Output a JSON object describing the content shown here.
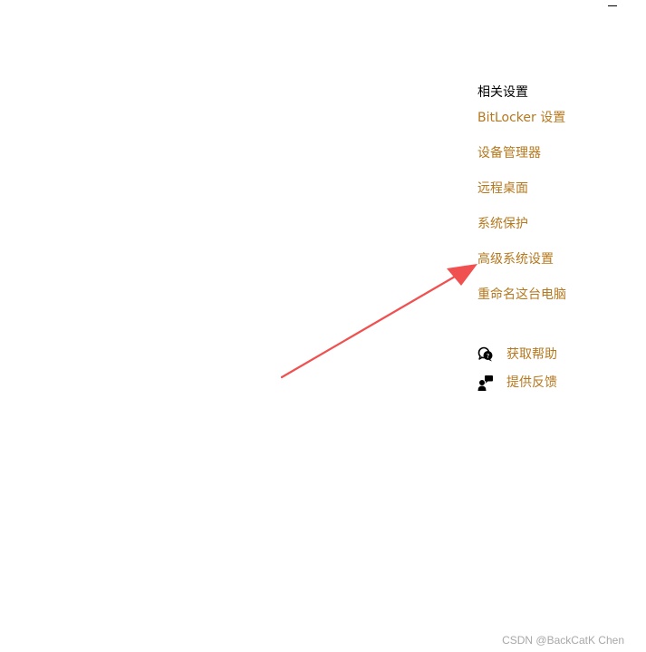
{
  "window": {
    "minimize_glyph": ""
  },
  "related": {
    "title": "相关设置",
    "links": [
      "BitLocker 设置",
      "设备管理器",
      "远程桌面",
      "系统保护",
      "高级系统设置",
      "重命名这台电脑"
    ]
  },
  "help": {
    "get_help": {
      "label": "获取帮助",
      "icon": "chat-bubbles-icon"
    },
    "feedback": {
      "label": "提供反馈",
      "icon": "person-feedback-icon"
    }
  },
  "watermark": "CSDN @BackCatK Chen",
  "colors": {
    "link": "#b5781e",
    "arrow": "#f05050"
  }
}
